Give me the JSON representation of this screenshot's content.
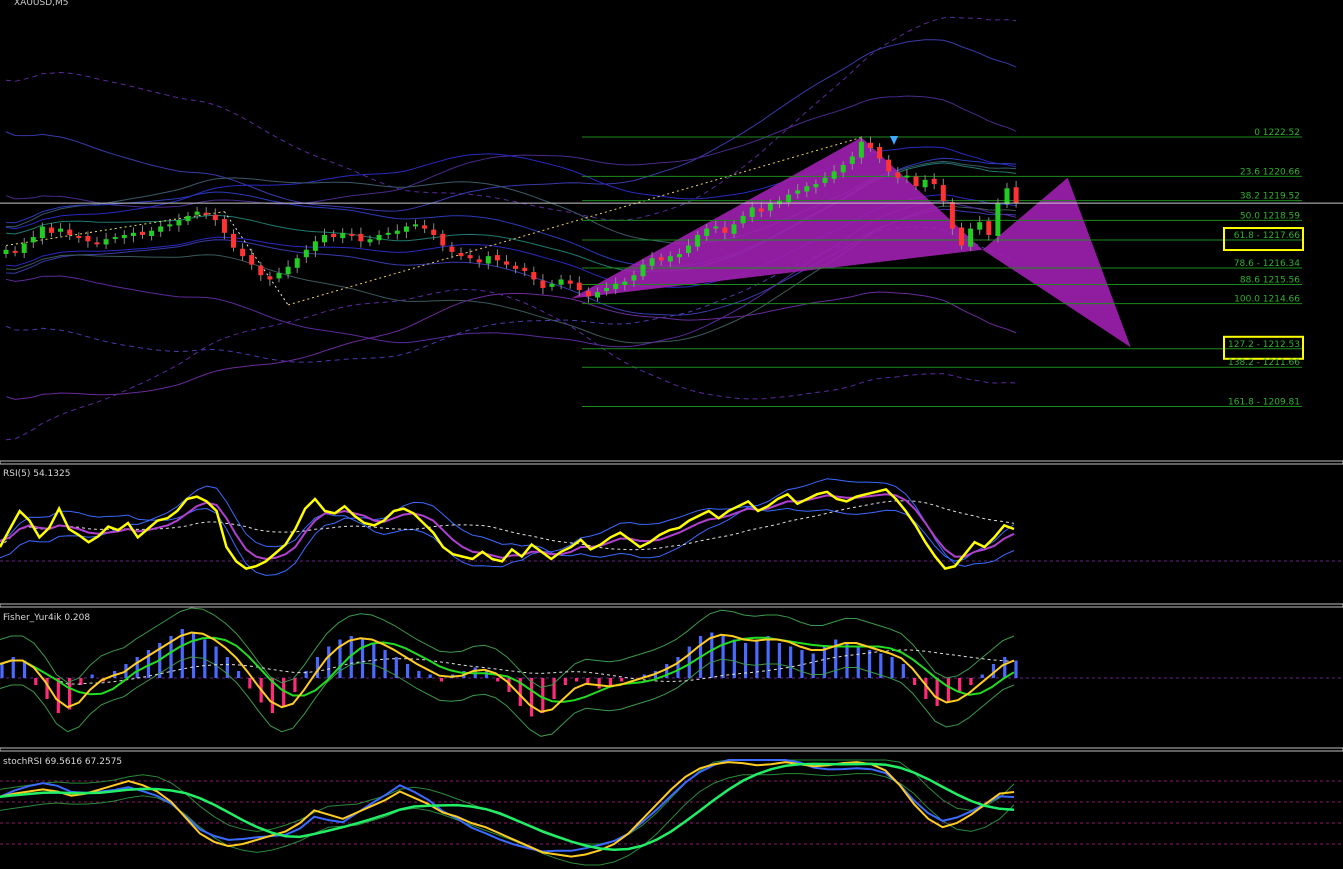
{
  "window": {
    "symbol_label": "XAUUSD,M5"
  },
  "main": {
    "price_line": 1219.4,
    "fib_levels": [
      {
        "label": "0 1222.52",
        "price": 1222.52
      },
      {
        "label": "23.6 1220.66",
        "price": 1220.66
      },
      {
        "label": "38.2 1219.52",
        "price": 1219.52
      },
      {
        "label": "50.0 1218.59",
        "price": 1218.59
      },
      {
        "label": "61.8 - 1217.66",
        "price": 1217.66,
        "highlight": true
      },
      {
        "label": "78.6 - 1216.34",
        "price": 1216.34
      },
      {
        "label": "88.6 1215.56",
        "price": 1215.56
      },
      {
        "label": "100.0 1214.66",
        "price": 1214.66
      },
      {
        "label": "127.2 - 1212.53",
        "price": 1212.53,
        "highlight": true
      },
      {
        "label": "138.2 - 1211.66",
        "price": 1211.66
      },
      {
        "label": "161.8 - 1209.81",
        "price": 1209.81
      }
    ],
    "colors": {
      "bull": "#22cc22",
      "bear": "#ff3333",
      "fib": "#1e8a1e",
      "fib_text": "#2fb02f",
      "harmonic": "#a020b0",
      "highlight": "#ffff00"
    }
  },
  "rsi_panel": {
    "label": "RSI(5) 54.1325"
  },
  "fisher_panel": {
    "label": "Fisher_Yur4ik 0.208"
  },
  "stoch_panel": {
    "label": "stochRSI 69.5616 67.2575"
  },
  "chart_data": [
    {
      "type": "candlestick",
      "symbol": "XAUUSD",
      "timeframe": "M5",
      "price_axis": [
        1208,
        1224
      ],
      "close_series": [
        1217.2,
        1217.1,
        1217.5,
        1217.8,
        1218.3,
        1218.0,
        1218.2,
        1217.9,
        1217.8,
        1217.6,
        1217.5,
        1217.7,
        1217.8,
        1217.9,
        1218.0,
        1217.9,
        1218.1,
        1218.3,
        1218.4,
        1218.6,
        1218.8,
        1219.0,
        1218.9,
        1218.6,
        1218.0,
        1217.3,
        1216.9,
        1216.5,
        1216.0,
        1215.8,
        1216.1,
        1216.4,
        1216.8,
        1217.2,
        1217.6,
        1217.9,
        1217.8,
        1218.0,
        1217.9,
        1217.6,
        1217.7,
        1217.9,
        1218.0,
        1218.1,
        1218.3,
        1218.4,
        1218.2,
        1217.9,
        1217.4,
        1217.1,
        1216.9,
        1216.8,
        1216.6,
        1216.9,
        1216.7,
        1216.5,
        1216.3,
        1216.2,
        1215.8,
        1215.4,
        1215.6,
        1215.8,
        1215.6,
        1215.3,
        1215.0,
        1215.2,
        1215.4,
        1215.6,
        1215.7,
        1216.0,
        1216.5,
        1216.8,
        1216.7,
        1216.9,
        1217.0,
        1217.4,
        1217.9,
        1218.2,
        1218.3,
        1218.0,
        1218.4,
        1218.8,
        1219.2,
        1219.0,
        1219.4,
        1219.5,
        1219.8,
        1220.0,
        1220.2,
        1220.3,
        1220.6,
        1220.9,
        1221.2,
        1221.6,
        1222.3,
        1222.0,
        1221.5,
        1220.9,
        1220.6,
        1220.7,
        1220.2,
        1220.5,
        1220.3,
        1219.5,
        1218.2,
        1217.4,
        1218.2,
        1218.5,
        1217.9,
        1219.4,
        1220.1,
        1219.4
      ]
    },
    {
      "type": "line",
      "name": "RSI(5)",
      "y_range": [
        0,
        100
      ],
      "values": [
        40,
        55,
        70,
        62,
        48,
        56,
        72,
        55,
        50,
        44,
        49,
        57,
        54,
        60,
        48,
        55,
        62,
        64,
        70,
        80,
        82,
        78,
        70,
        40,
        28,
        22,
        24,
        28,
        35,
        42,
        55,
        72,
        80,
        70,
        68,
        74,
        66,
        60,
        58,
        62,
        70,
        72,
        68,
        60,
        52,
        40,
        34,
        32,
        30,
        36,
        30,
        28,
        38,
        32,
        42,
        36,
        30,
        36,
        40,
        46,
        38,
        42,
        48,
        52,
        46,
        40,
        44,
        50,
        54,
        56,
        62,
        66,
        70,
        64,
        70,
        74,
        78,
        70,
        74,
        80,
        84,
        76,
        80,
        84,
        86,
        80,
        78,
        82,
        84,
        86,
        88,
        80,
        70,
        58,
        44,
        32,
        22,
        24,
        34,
        44,
        40,
        48,
        58,
        55
      ],
      "signal": [
        45,
        48,
        55,
        58,
        56,
        55,
        58,
        57,
        55,
        52,
        51,
        52,
        53,
        55,
        53,
        54,
        56,
        58,
        62,
        68,
        74,
        77,
        75,
        64,
        50,
        38,
        32,
        30,
        31,
        34,
        40,
        52,
        62,
        68,
        68,
        70,
        68,
        66,
        62,
        61,
        64,
        67,
        68,
        66,
        62,
        54,
        46,
        40,
        36,
        35,
        33,
        31,
        33,
        33,
        36,
        36,
        34,
        34,
        36,
        40,
        40,
        41,
        44,
        47,
        47,
        45,
        45,
        46,
        49,
        52,
        56,
        60,
        63,
        64,
        66,
        69,
        72,
        71,
        72,
        75,
        78,
        78,
        79,
        81,
        83,
        82,
        81,
        81,
        82,
        83,
        84,
        83,
        79,
        71,
        60,
        48,
        38,
        32,
        32,
        36,
        38,
        41,
        47,
        51
      ]
    },
    {
      "type": "bar+line",
      "name": "Fisher_Yur4ik",
      "y_range": [
        -1,
        1
      ],
      "histogram": [
        0.2,
        0.3,
        0.25,
        -0.1,
        -0.3,
        -0.5,
        -0.45,
        -0.1,
        0.05,
        -0.05,
        0.1,
        0.2,
        0.3,
        0.4,
        0.5,
        0.6,
        0.7,
        0.65,
        0.55,
        0.45,
        0.3,
        0.1,
        -0.15,
        -0.35,
        -0.5,
        -0.4,
        -0.2,
        0.1,
        0.3,
        0.45,
        0.55,
        0.6,
        0.55,
        0.5,
        0.4,
        0.3,
        0.2,
        0.1,
        0.05,
        -0.05,
        0.05,
        0.1,
        0.15,
        0.1,
        -0.05,
        -0.2,
        -0.4,
        -0.55,
        -0.5,
        -0.3,
        -0.1,
        -0.05,
        -0.1,
        -0.15,
        -0.1,
        -0.05,
        0.0,
        0.05,
        0.1,
        0.2,
        0.3,
        0.45,
        0.6,
        0.65,
        0.6,
        0.55,
        0.5,
        0.55,
        0.6,
        0.5,
        0.45,
        0.4,
        0.35,
        0.45,
        0.55,
        0.5,
        0.45,
        0.4,
        0.35,
        0.3,
        0.2,
        -0.1,
        -0.3,
        -0.4,
        -0.35,
        -0.2,
        -0.1,
        0.05,
        0.2,
        0.3,
        0.25
      ]
    },
    {
      "type": "line",
      "name": "stochRSI",
      "y_range": [
        0,
        100
      ],
      "k": [
        65,
        68,
        70,
        72,
        70,
        66,
        68,
        72,
        76,
        80,
        76,
        70,
        60,
        45,
        30,
        22,
        18,
        20,
        24,
        28,
        32,
        40,
        52,
        48,
        44,
        50,
        56,
        62,
        70,
        64,
        58,
        50,
        46,
        40,
        36,
        30,
        24,
        18,
        12,
        10,
        8,
        10,
        14,
        20,
        30,
        44,
        58,
        72,
        84,
        92,
        96,
        98,
        97,
        95,
        96,
        98,
        96,
        94,
        95,
        97,
        98,
        96,
        90,
        76,
        58,
        44,
        36,
        40,
        48,
        58,
        68,
        69.5616
      ],
      "d": [
        62,
        64,
        66,
        68,
        69,
        68,
        68,
        69,
        71,
        74,
        76,
        74,
        68,
        58,
        46,
        36,
        28,
        24,
        22,
        24,
        28,
        33,
        40,
        46,
        47,
        48,
        52,
        56,
        62,
        64,
        62,
        58,
        53,
        48,
        43,
        38,
        33,
        27,
        21,
        16,
        12,
        10,
        10,
        13,
        19,
        28,
        40,
        54,
        68,
        80,
        88,
        93,
        96,
        96,
        96,
        97,
        97,
        96,
        95,
        96,
        97,
        97,
        94,
        88,
        78,
        64,
        52,
        44,
        42,
        46,
        54,
        67.2575
      ]
    }
  ]
}
